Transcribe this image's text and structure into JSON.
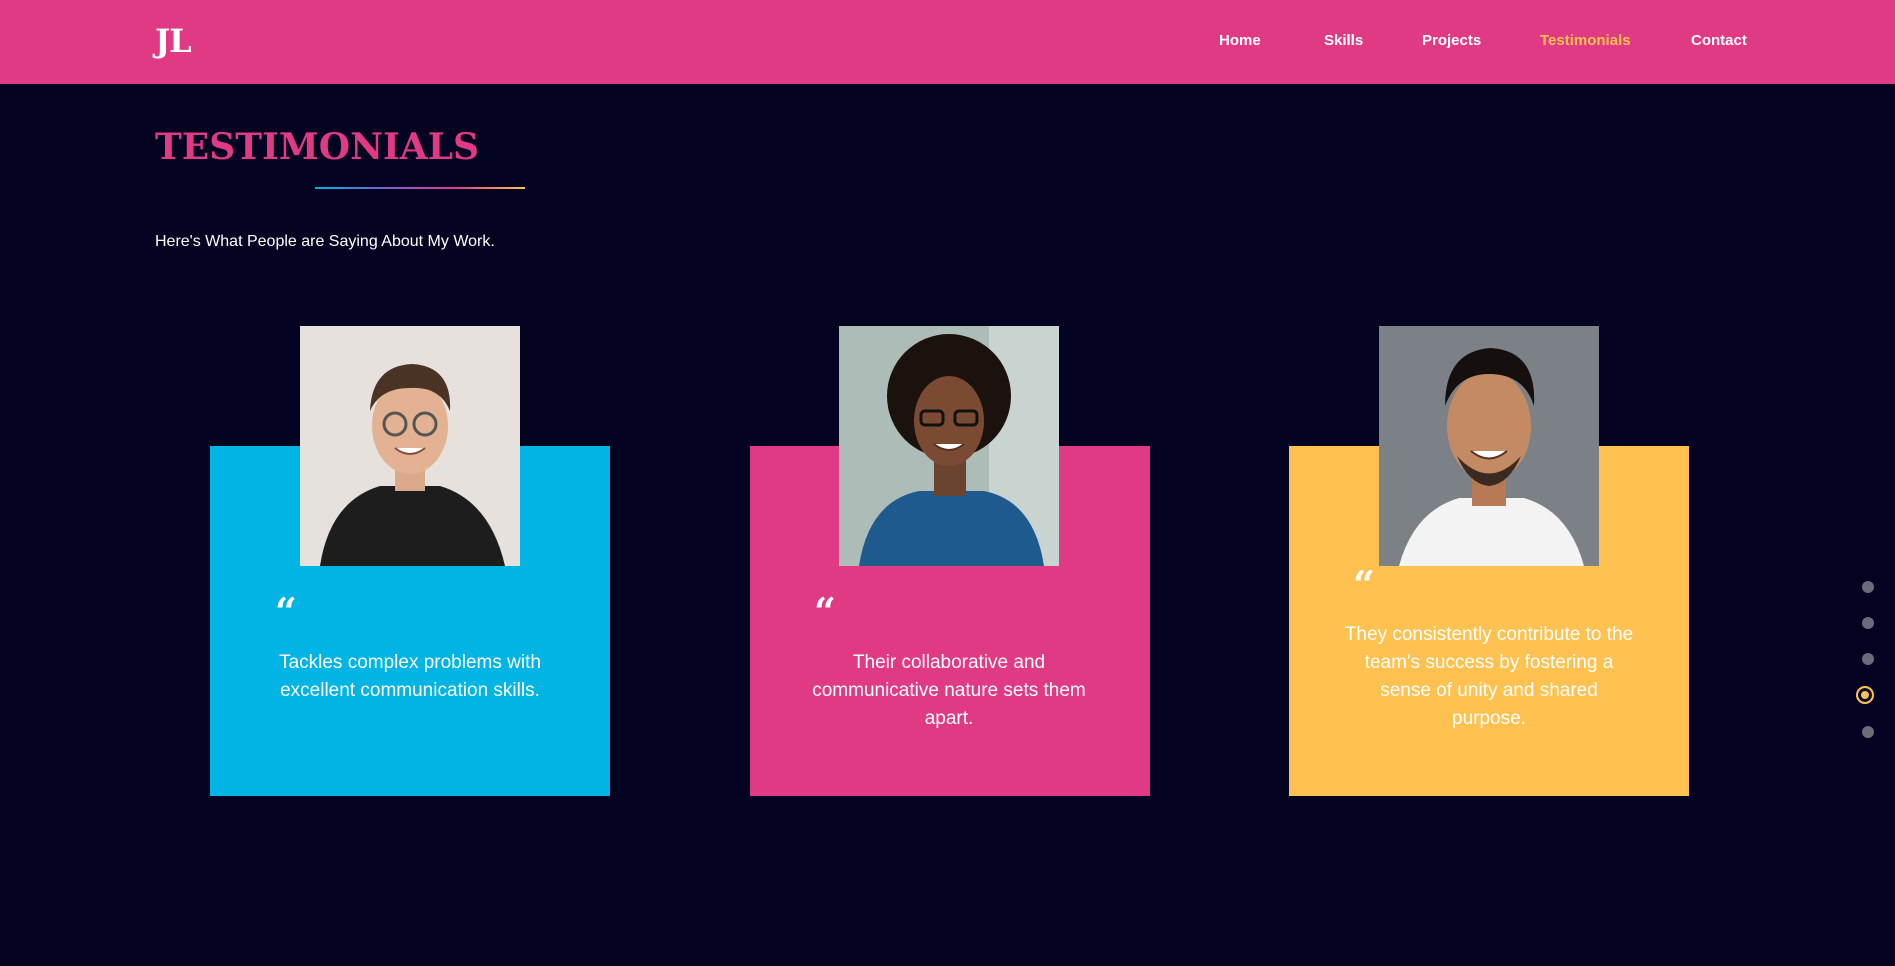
{
  "header": {
    "logo": "JL",
    "nav": [
      {
        "label": "Home",
        "active": false
      },
      {
        "label": "Skills",
        "active": false
      },
      {
        "label": "Projects",
        "active": false
      },
      {
        "label": "Testimonials",
        "active": true
      },
      {
        "label": "Contact",
        "active": false
      }
    ]
  },
  "section": {
    "title": "TESTIMONIALS",
    "subtitle": "Here's What People are Saying About My Work."
  },
  "testimonials": [
    {
      "quote_mark": "“",
      "text": "Tackles complex problems with excellent communication skills.",
      "color": "#00b4e3"
    },
    {
      "quote_mark": "“",
      "text": "Their collaborative and communicative nature sets them apart.",
      "color": "#e03a85"
    },
    {
      "quote_mark": "“",
      "text": "They consistently contribute to the team's success by fostering a sense of unity and shared purpose.",
      "color": "#ffc250"
    }
  ],
  "page_dots": {
    "count": 5,
    "active_index": 3
  },
  "colors": {
    "brand_pink": "#e03a85",
    "accent_yellow": "#ffc250",
    "accent_blue": "#00b4e3",
    "background": "#050322"
  }
}
